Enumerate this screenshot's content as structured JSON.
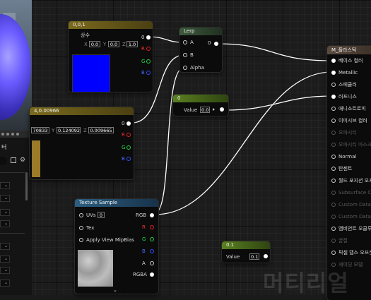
{
  "colors": {
    "const3_header": "#7a6a1c",
    "const_header": "#5a8020",
    "lerp_header": "#3c5a3c",
    "texture_header": "#2d5f82",
    "material_header": "#5a4a3e",
    "preview_blue": "#0000ff",
    "constant4_swatch": "#9b7a2a",
    "wire": "#ffffff"
  },
  "constant3": {
    "title": "0,0,1",
    "label": "상수",
    "x_label": "X",
    "x_value": "0.0",
    "y_label": "Y",
    "y_value": "0.0",
    "z_label": "Z",
    "z_value": "1.0",
    "out_labels": [
      "0",
      "R",
      "G",
      "B"
    ],
    "preview_color": "#0000ff"
  },
  "lerp": {
    "title": "Lerp",
    "pins": [
      "A",
      "B",
      "Alpha"
    ],
    "out_label": "0"
  },
  "constant4": {
    "title": "4,0.00966",
    "x_value": "70833",
    "y_label": "Y",
    "y_value": "0.124092",
    "z_label": "Z",
    "z_value": "0.009665",
    "out_labels": [
      "0",
      "R",
      "G",
      "B"
    ]
  },
  "constant_value": {
    "title": "0",
    "label": "Value",
    "value": "0.0"
  },
  "constant_value2": {
    "title": "0.1",
    "label": "Value",
    "value": "0.1"
  },
  "texture_sample": {
    "title": "Texture Sample",
    "inputs": [
      {
        "label": "UVs",
        "value": "0"
      },
      {
        "label": "Tex"
      },
      {
        "label": "Apply View MipBias"
      }
    ],
    "outputs": [
      "RGB",
      "R",
      "G",
      "B",
      "A",
      "RGBA"
    ]
  },
  "material": {
    "title": "M_플라스틱",
    "inputs": [
      {
        "label": "베이스 컬러",
        "dim": false,
        "connected": true
      },
      {
        "label": "Metallic",
        "dim": false,
        "connected": true
      },
      {
        "label": "스페큘러",
        "dim": false,
        "connected": false
      },
      {
        "label": "러프니스",
        "dim": false,
        "connected": true
      },
      {
        "label": "애니소트로피",
        "dim": false,
        "connected": false
      },
      {
        "label": "이미시브 컬러",
        "dim": false,
        "connected": false
      },
      {
        "label": "오파시티",
        "dim": true,
        "connected": false
      },
      {
        "label": "오파시티 마스크",
        "dim": true,
        "connected": false
      },
      {
        "label": "Normal",
        "dim": false,
        "connected": false
      },
      {
        "label": "탄젠트",
        "dim": false,
        "connected": false
      },
      {
        "label": "월드 포지션 오프",
        "dim": false,
        "connected": false
      },
      {
        "label": "Subsurface Color",
        "dim": true,
        "connected": false
      },
      {
        "label": "Custom Data 0",
        "dim": true,
        "connected": false
      },
      {
        "label": "Custom Data 1",
        "dim": true,
        "connected": false
      },
      {
        "label": "앰비언트 오클루",
        "dim": false,
        "connected": false
      },
      {
        "label": "굴절",
        "dim": true,
        "connected": false
      },
      {
        "label": "픽셀 뎁스 오프셋",
        "dim": false,
        "connected": false
      },
      {
        "label": "셰이딩 모델",
        "dim": true,
        "connected": false
      }
    ]
  },
  "left_panel": {
    "label": "터"
  },
  "watermark": "머티리얼"
}
